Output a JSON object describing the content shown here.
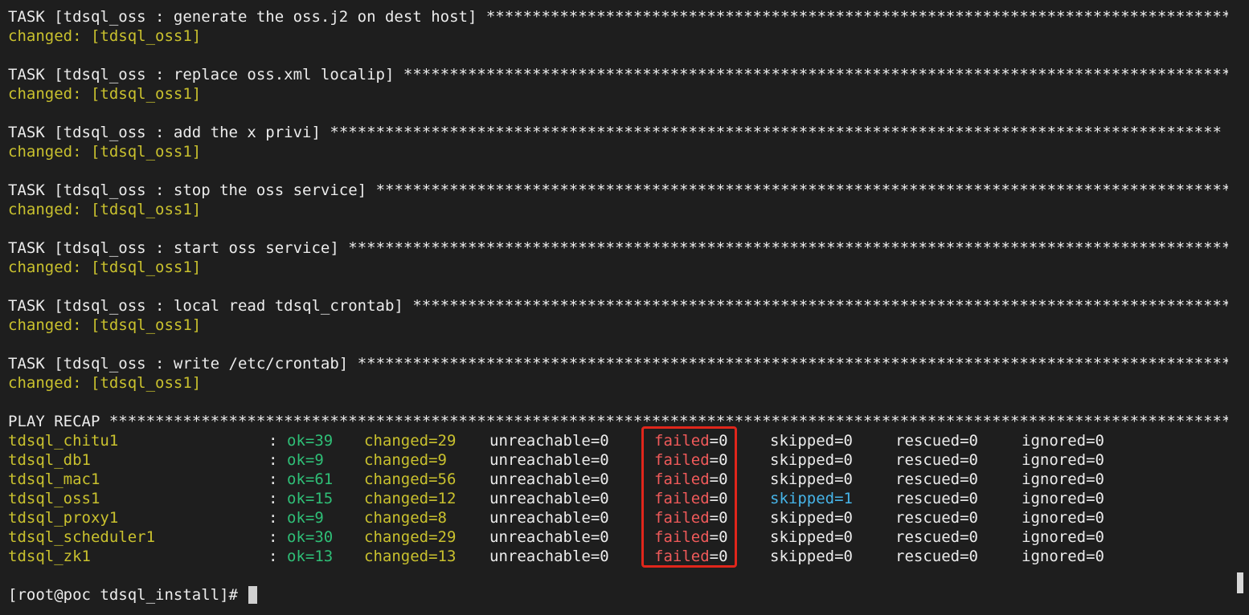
{
  "stars_line": "*************************************************************************************************",
  "tasks": [
    {
      "title": "TASK [tdsql_oss : generate the oss.j2 on dest host] ",
      "result": "changed: [tdsql_oss1]"
    },
    {
      "title": "TASK [tdsql_oss : replace oss.xml localip] ",
      "result": "changed: [tdsql_oss1]"
    },
    {
      "title": "TASK [tdsql_oss : add the x privi] ",
      "result": "changed: [tdsql_oss1]"
    },
    {
      "title": "TASK [tdsql_oss : stop the oss service] ",
      "result": "changed: [tdsql_oss1]"
    },
    {
      "title": "TASK [tdsql_oss : start oss service] ",
      "result": "changed: [tdsql_oss1]"
    },
    {
      "title": "TASK [tdsql_oss : local read tdsql_crontab] ",
      "result": "changed: [tdsql_oss1]"
    },
    {
      "title": "TASK [tdsql_oss : write /etc/crontab] ",
      "result": "changed: [tdsql_oss1]"
    }
  ],
  "recap": {
    "title": "PLAY RECAP ",
    "rows": [
      {
        "host": "tdsql_chitu1",
        "ok": "ok=39",
        "changed": "changed=29",
        "unreachable": "unreachable=0",
        "failed_label": "failed",
        "failed_value": "=0",
        "skipped": "skipped=0",
        "rescued": "rescued=0",
        "ignored": "ignored=0"
      },
      {
        "host": "tdsql_db1",
        "ok": "ok=9",
        "changed": "changed=9",
        "unreachable": "unreachable=0",
        "failed_label": "failed",
        "failed_value": "=0",
        "skipped": "skipped=0",
        "rescued": "rescued=0",
        "ignored": "ignored=0"
      },
      {
        "host": "tdsql_mac1",
        "ok": "ok=61",
        "changed": "changed=56",
        "unreachable": "unreachable=0",
        "failed_label": "failed",
        "failed_value": "=0",
        "skipped": "skipped=0",
        "rescued": "rescued=0",
        "ignored": "ignored=0"
      },
      {
        "host": "tdsql_oss1",
        "ok": "ok=15",
        "changed": "changed=12",
        "unreachable": "unreachable=0",
        "failed_label": "failed",
        "failed_value": "=0",
        "skipped": "skipped=1",
        "rescued": "rescued=0",
        "ignored": "ignored=0"
      },
      {
        "host": "tdsql_proxy1",
        "ok": "ok=9",
        "changed": "changed=8",
        "unreachable": "unreachable=0",
        "failed_label": "failed",
        "failed_value": "=0",
        "skipped": "skipped=0",
        "rescued": "rescued=0",
        "ignored": "ignored=0"
      },
      {
        "host": "tdsql_scheduler1",
        "ok": "ok=30",
        "changed": "changed=29",
        "unreachable": "unreachable=0",
        "failed_label": "failed",
        "failed_value": "=0",
        "skipped": "skipped=0",
        "rescued": "rescued=0",
        "ignored": "ignored=0"
      },
      {
        "host": "tdsql_zk1",
        "ok": "ok=13",
        "changed": "changed=13",
        "unreachable": "unreachable=0",
        "failed_label": "failed",
        "failed_value": "=0",
        "skipped": "skipped=0",
        "rescued": "rescued=0",
        "ignored": "ignored=0"
      }
    ]
  },
  "prompt": "[root@poc tdsql_install]# ",
  "colors": {
    "background": "#1e1e1e",
    "changed_yellow": "#c9c12e",
    "ok_green": "#2fbf77",
    "failed_red": "#f05a5a",
    "skipped_blue": "#46b4e8",
    "highlight_border": "#e0261b"
  }
}
